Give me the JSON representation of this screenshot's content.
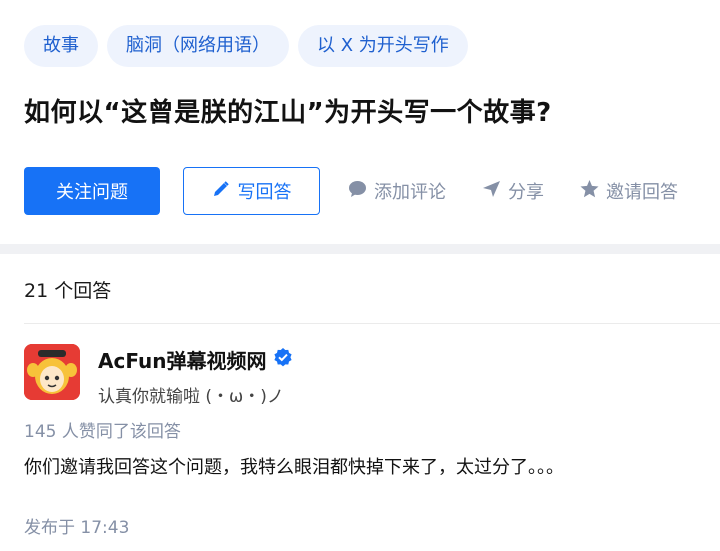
{
  "tags": [
    "故事",
    "脑洞（网络用语）",
    "以 X 为开头写作"
  ],
  "question": {
    "title": "如何以“这曾是朕的江山”为开头写一个故事?"
  },
  "actions": {
    "follow": "关注问题",
    "write": "写回答",
    "comment": "添加评论",
    "share": "分享",
    "invite": "邀请回答"
  },
  "answers": {
    "count": "21 个回答",
    "first": {
      "author_name": "AcFun弹幕视频网",
      "author_bio": "认真你就输啦 (・ω・)ノ",
      "votes": "145 人赞同了该回答",
      "content": "你们邀请我回答这个问题，我特么眼泪都快掉下来了，太过分了。。。",
      "time": "发布于 17:43"
    }
  },
  "colors": {
    "accent": "#1772f6",
    "tag_bg": "#eef3fd",
    "muted": "#8590a6",
    "verified": "#1772f6",
    "avatar_bg": "#e63b34"
  },
  "icons": [
    "pencil-icon",
    "comment-icon",
    "share-icon",
    "star-icon",
    "verified-badge-icon"
  ]
}
